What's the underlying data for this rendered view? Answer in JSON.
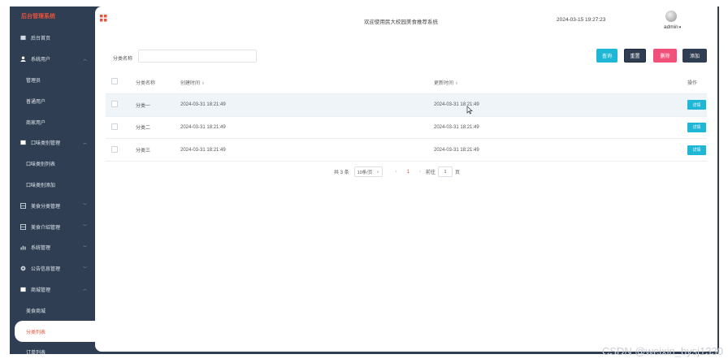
{
  "app": {
    "brand": "后台管理系统"
  },
  "sidebar": {
    "items": [
      {
        "label": "后台首页",
        "icon": "home-icon",
        "type": "top"
      },
      {
        "label": "系统用户",
        "icon": "user-icon",
        "type": "group",
        "expanded": true
      },
      {
        "label": "管理员",
        "type": "sub"
      },
      {
        "label": "普通用户",
        "type": "sub"
      },
      {
        "label": "商家用户",
        "type": "sub"
      },
      {
        "label": "口味类别管理",
        "icon": "folder-icon",
        "type": "group",
        "expanded": true
      },
      {
        "label": "口味类别列表",
        "type": "sub"
      },
      {
        "label": "口味类别添加",
        "type": "sub"
      },
      {
        "label": "美食分类管理",
        "icon": "grid-icon",
        "type": "group",
        "expanded": false
      },
      {
        "label": "美食介绍管理",
        "icon": "grid-icon",
        "type": "group",
        "expanded": false
      },
      {
        "label": "系统管理",
        "icon": "chart-icon",
        "type": "group",
        "expanded": false
      },
      {
        "label": "公告信息管理",
        "icon": "settings-icon",
        "type": "group",
        "expanded": false
      },
      {
        "label": "商城管理",
        "icon": "shop-icon",
        "type": "group",
        "expanded": true
      },
      {
        "label": "美食商城",
        "type": "sub"
      },
      {
        "label": "分类列表",
        "type": "sub",
        "active": true
      },
      {
        "label": "订单列表",
        "type": "sub"
      }
    ]
  },
  "header": {
    "welcome": "欢迎使用民大校园美食推荐系统",
    "datetime": "2024-03-15 19:27:23",
    "user": "admin"
  },
  "search": {
    "label": "分类名称",
    "value": "",
    "placeholder": "",
    "buttons": {
      "query": "查询",
      "reset": "重置",
      "delete": "删除",
      "add": "添加"
    }
  },
  "table": {
    "headers": {
      "name": "分类名称",
      "created": "创建时间",
      "updated": "更新时间",
      "action": "操作"
    },
    "rows": [
      {
        "name": "分类一",
        "created": "2024-03-31 18:21:49",
        "updated": "2024-03-31 18:21:49",
        "action": "详情"
      },
      {
        "name": "分类二",
        "created": "2024-03-31 18:21:49",
        "updated": "2024-03-31 18:21:49",
        "action": "详情"
      },
      {
        "name": "分类三",
        "created": "2024-03-31 18:21:49",
        "updated": "2024-03-31 18:21:49",
        "action": "详情"
      }
    ]
  },
  "pagination": {
    "total": "共 3 条",
    "page_size": "10条/页",
    "current_page": "1",
    "goto_label": "前往",
    "goto_value": "1",
    "page_suffix": "页"
  },
  "watermark": "CSDN @weixin_bysj1330",
  "colors": {
    "sidebar_bg": "#2f3e52",
    "accent": "#e8543c",
    "primary": "#1fb7d6",
    "danger": "#f0507a"
  }
}
